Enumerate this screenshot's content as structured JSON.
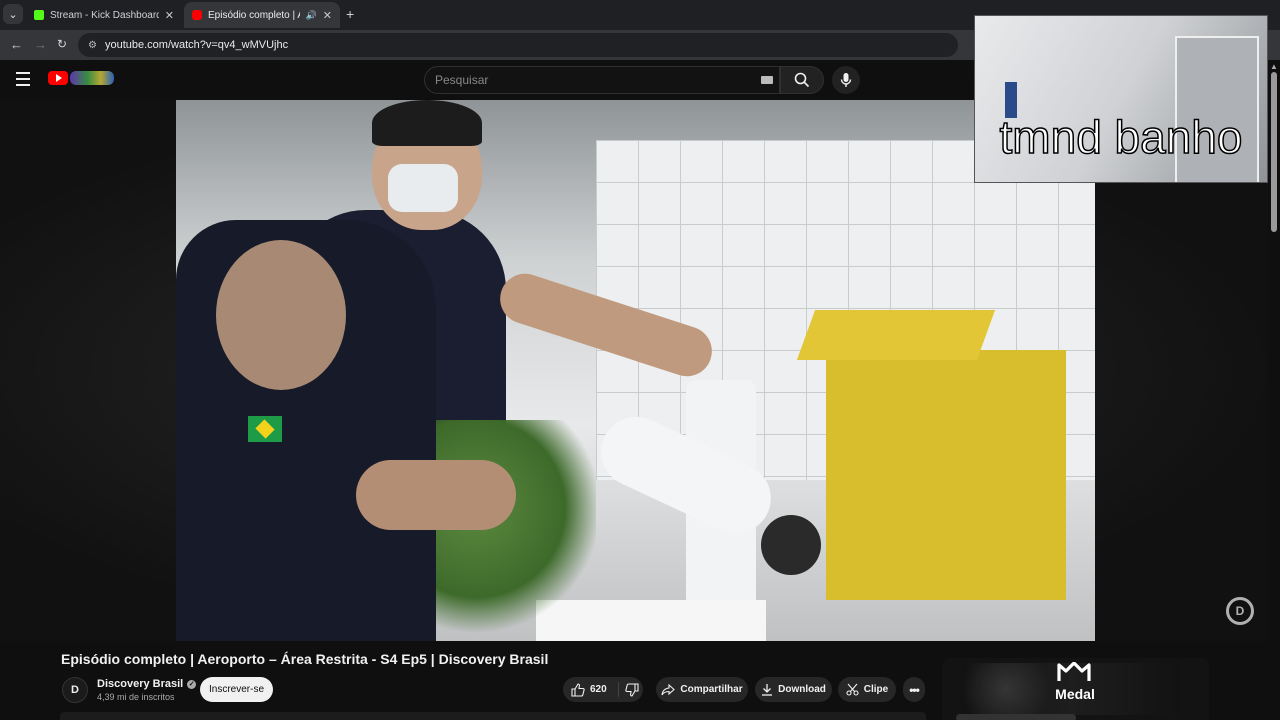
{
  "browser": {
    "tabs": [
      {
        "title": "Stream - Kick Dashboard",
        "favicon_color": "#53fc18",
        "active": false
      },
      {
        "title": "Episódio completo | Aeroporto – Área Restrita - S4 Ep5 | Discovery Brasil",
        "favicon_color": "#ff0000",
        "active": true
      }
    ],
    "url": "youtube.com/watch?v=qv4_wMVUjhc"
  },
  "youtube": {
    "search_placeholder": "Pesquisar"
  },
  "webcam": {
    "caption": "tmnd banho"
  },
  "video": {
    "title": "Episódio completo | Aeroporto – Área Restrita - S4 Ep5 | Discovery Brasil",
    "watermark": "D"
  },
  "channel": {
    "avatar_letter": "D",
    "name": "Discovery Brasil",
    "subscribers": "4,39 mi de inscritos",
    "subscribe_label": "Inscrever-se"
  },
  "actions": {
    "likes": "620",
    "share_label": "Compartilhar",
    "download_label": "Download",
    "clip_label": "Clipe"
  },
  "ad": {
    "brand": "Medal"
  },
  "colors": {
    "youtube_red": "#ff0000",
    "kick_green": "#53fc18",
    "background": "#0f0f0f"
  }
}
